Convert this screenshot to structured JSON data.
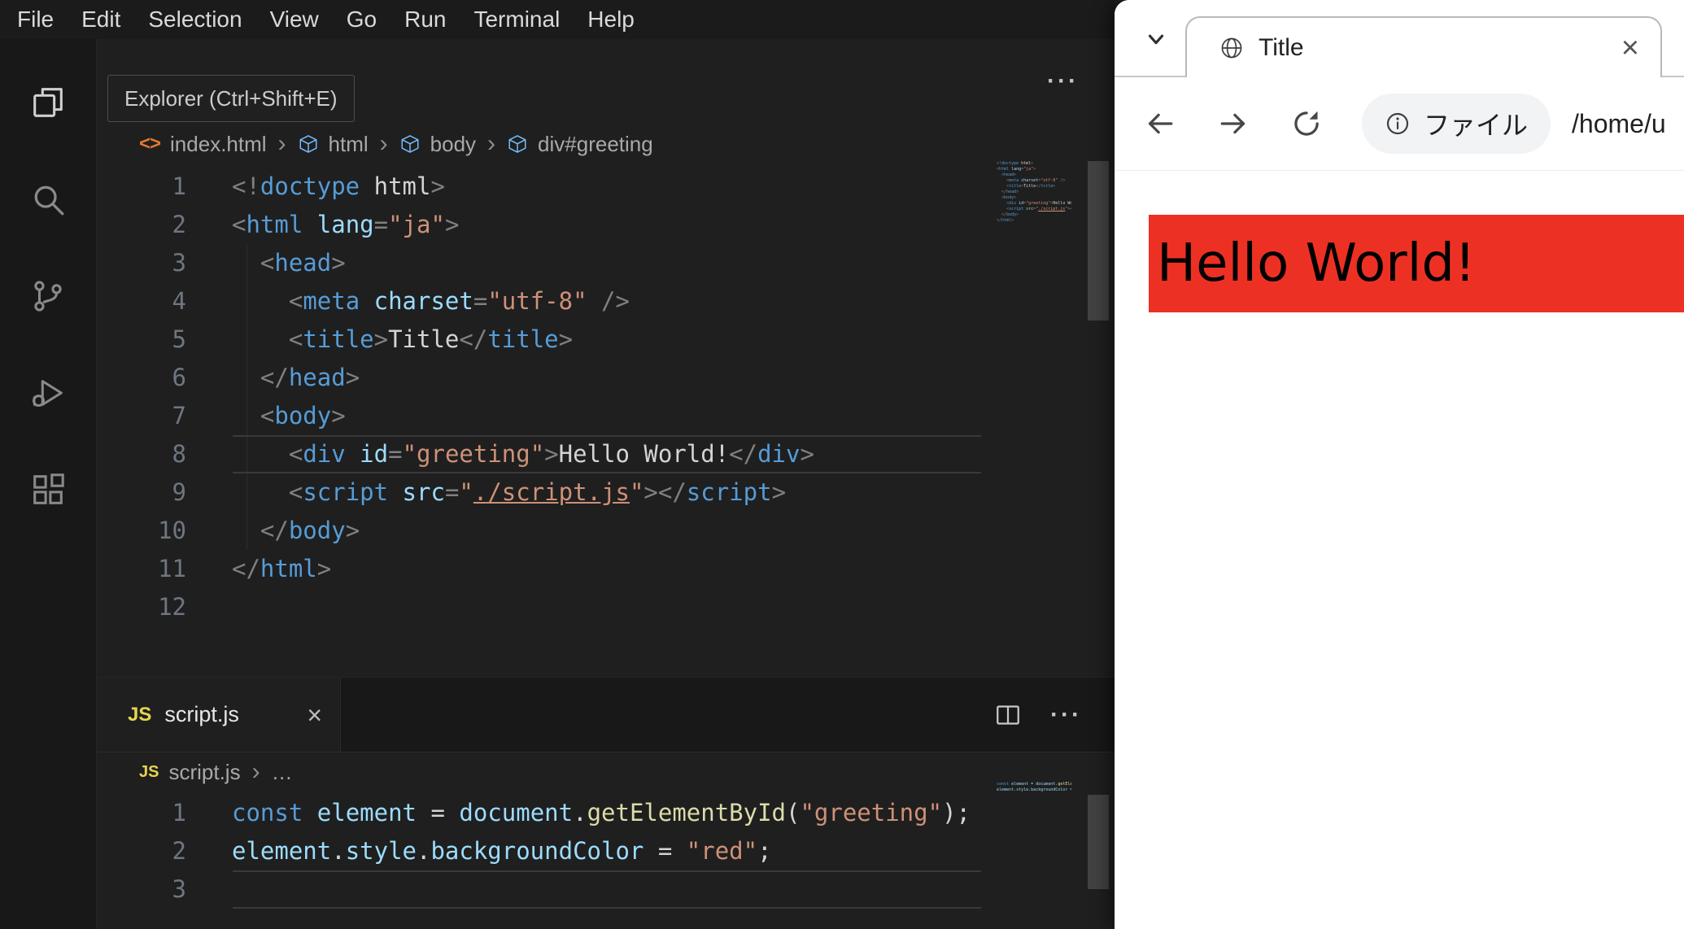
{
  "vscode": {
    "menu_bar": [
      "File",
      "Edit",
      "Selection",
      "View",
      "Go",
      "Run",
      "Terminal",
      "Help"
    ],
    "tooltip": "Explorer (Ctrl+Shift+E)",
    "activity_bar": [
      "explorer",
      "search",
      "source-control",
      "run-debug",
      "extensions"
    ],
    "editor_html": {
      "more_label": "···",
      "breadcrumb": {
        "file": "index.html",
        "separator": "›",
        "path": [
          "html",
          "body",
          "div#greeting"
        ]
      },
      "current_line": 8,
      "lines": [
        {
          "n": "1",
          "t": [
            [
              "<!",
              "p"
            ],
            [
              "doctype",
              "t"
            ],
            [
              " ",
              "x"
            ],
            [
              "html",
              "x"
            ],
            [
              ">",
              "p"
            ]
          ]
        },
        {
          "n": "2",
          "t": [
            [
              "<",
              "p"
            ],
            [
              "html",
              "t"
            ],
            [
              " ",
              "x"
            ],
            [
              "lang",
              "a"
            ],
            [
              "=",
              "p"
            ],
            [
              "\"ja\"",
              "s"
            ],
            [
              ">",
              "p"
            ]
          ]
        },
        {
          "n": "3",
          "t": [
            [
              "  ",
              "x"
            ],
            [
              "<",
              "p"
            ],
            [
              "head",
              "t"
            ],
            [
              ">",
              "p"
            ]
          ]
        },
        {
          "n": "4",
          "t": [
            [
              "    ",
              "x"
            ],
            [
              "<",
              "p"
            ],
            [
              "meta",
              "t"
            ],
            [
              " ",
              "x"
            ],
            [
              "charset",
              "a"
            ],
            [
              "=",
              "p"
            ],
            [
              "\"utf-8\"",
              "s"
            ],
            [
              " ",
              "x"
            ],
            [
              "/>",
              "p"
            ]
          ]
        },
        {
          "n": "5",
          "t": [
            [
              "    ",
              "x"
            ],
            [
              "<",
              "p"
            ],
            [
              "title",
              "t"
            ],
            [
              ">",
              "p"
            ],
            [
              "Title",
              "x"
            ],
            [
              "</",
              "p"
            ],
            [
              "title",
              "t"
            ],
            [
              ">",
              "p"
            ]
          ]
        },
        {
          "n": "6",
          "t": [
            [
              "  ",
              "x"
            ],
            [
              "</",
              "p"
            ],
            [
              "head",
              "t"
            ],
            [
              ">",
              "p"
            ]
          ]
        },
        {
          "n": "7",
          "t": [
            [
              "  ",
              "x"
            ],
            [
              "<",
              "p"
            ],
            [
              "body",
              "t"
            ],
            [
              ">",
              "p"
            ]
          ]
        },
        {
          "n": "8",
          "t": [
            [
              "    ",
              "x"
            ],
            [
              "<",
              "p"
            ],
            [
              "div",
              "t"
            ],
            [
              " ",
              "x"
            ],
            [
              "id",
              "a"
            ],
            [
              "=",
              "p"
            ],
            [
              "\"greeting\"",
              "s"
            ],
            [
              ">",
              "p"
            ],
            [
              "Hello World!",
              "x"
            ],
            [
              "</",
              "p"
            ],
            [
              "div",
              "t"
            ],
            [
              ">",
              "p"
            ]
          ]
        },
        {
          "n": "9",
          "t": [
            [
              "    ",
              "x"
            ],
            [
              "<",
              "p"
            ],
            [
              "script",
              "t"
            ],
            [
              " ",
              "x"
            ],
            [
              "src",
              "a"
            ],
            [
              "=",
              "p"
            ],
            [
              "\"",
              "s"
            ],
            [
              "./script.js",
              "l"
            ],
            [
              "\"",
              "s"
            ],
            [
              "></",
              "p"
            ],
            [
              "script",
              "t"
            ],
            [
              ">",
              "p"
            ]
          ]
        },
        {
          "n": "10",
          "t": [
            [
              "  ",
              "x"
            ],
            [
              "</",
              "p"
            ],
            [
              "body",
              "t"
            ],
            [
              ">",
              "p"
            ]
          ]
        },
        {
          "n": "11",
          "t": [
            [
              "</",
              "p"
            ],
            [
              "html",
              "t"
            ],
            [
              ">",
              "p"
            ]
          ]
        },
        {
          "n": "12",
          "t": []
        }
      ]
    },
    "editor_js": {
      "tab": {
        "badge": "JS",
        "label": "script.js",
        "close": "×"
      },
      "more_label": "···",
      "breadcrumb": {
        "badge": "JS",
        "file": "script.js",
        "separator": "›",
        "ellipsis": "…"
      },
      "current_line": 3,
      "lines": [
        {
          "n": "1",
          "t": [
            [
              "const",
              "k"
            ],
            [
              " ",
              "x"
            ],
            [
              "element",
              "v"
            ],
            [
              " ",
              "x"
            ],
            [
              "=",
              "x"
            ],
            [
              " ",
              "x"
            ],
            [
              "document",
              "v"
            ],
            [
              ".",
              "x"
            ],
            [
              "getElementById",
              "f"
            ],
            [
              "(",
              "x"
            ],
            [
              "\"greeting\"",
              "s"
            ],
            [
              ")",
              "x"
            ],
            [
              ";",
              "x"
            ]
          ]
        },
        {
          "n": "2",
          "t": [
            [
              "element",
              "v"
            ],
            [
              ".",
              "x"
            ],
            [
              "style",
              "v"
            ],
            [
              ".",
              "x"
            ],
            [
              "backgroundColor",
              "v"
            ],
            [
              " ",
              "x"
            ],
            [
              "=",
              "x"
            ],
            [
              " ",
              "x"
            ],
            [
              "\"red\"",
              "s"
            ],
            [
              ";",
              "x"
            ]
          ]
        },
        {
          "n": "3",
          "t": []
        }
      ]
    }
  },
  "browser": {
    "tab_title": "Title",
    "close_label": "×",
    "address": {
      "chip": "ファイル",
      "path": "/home/u"
    },
    "page": {
      "text": "Hello World!",
      "background": "#ec3124"
    }
  }
}
